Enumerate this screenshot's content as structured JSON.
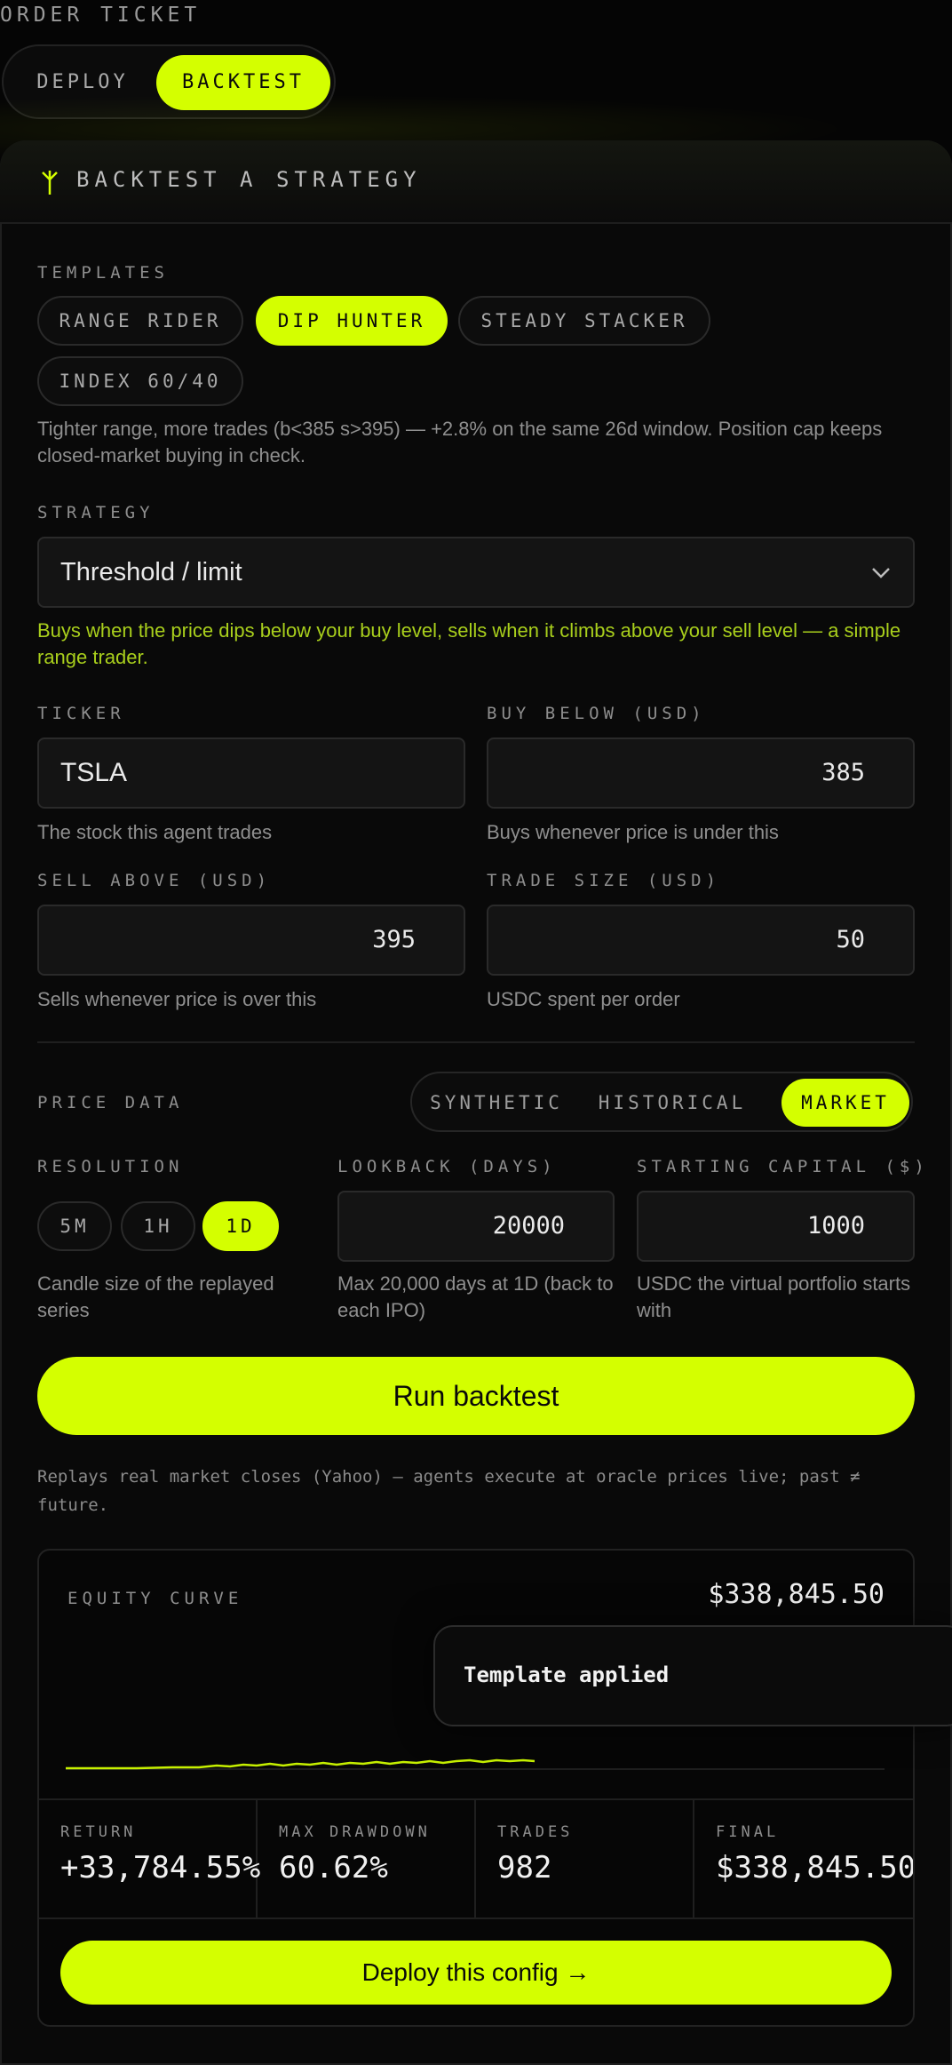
{
  "page_title": "ORDER TICKET",
  "mode_toggle": {
    "deploy": "DEPLOY",
    "backtest": "BACKTEST",
    "selected": "BACKTEST"
  },
  "card_title": "BACKTEST A STRATEGY",
  "templates": {
    "label": "TEMPLATES",
    "items": [
      "RANGE RIDER",
      "DIP HUNTER",
      "STEADY STACKER",
      "INDEX 60/40"
    ],
    "selected": "DIP HUNTER",
    "description": "Tighter range, more trades (b<385 s>395) — +2.8% on the same 26d window. Position cap keeps closed-market buying in check."
  },
  "strategy": {
    "label": "STRATEGY",
    "value": "Threshold / limit",
    "description": "Buys when the price dips below your buy level, sells when it climbs above your sell level — a simple range trader."
  },
  "ticker": {
    "label": "TICKER",
    "value": "TSLA",
    "help": "The stock this agent trades"
  },
  "buy_below": {
    "label": "BUY BELOW (USD)",
    "value": "385",
    "help": "Buys whenever price is under this"
  },
  "sell_above": {
    "label": "SELL ABOVE (USD)",
    "value": "395",
    "help": "Sells whenever price is over this"
  },
  "trade_size": {
    "label": "TRADE SIZE (USD)",
    "value": "50",
    "help": "USDC spent per order"
  },
  "price_data": {
    "label": "PRICE DATA",
    "options": [
      "SYNTHETIC",
      "HISTORICAL",
      "MARKET"
    ],
    "selected": "MARKET"
  },
  "resolution": {
    "label": "RESOLUTION",
    "options": [
      "5M",
      "1H",
      "1D"
    ],
    "selected": "1D",
    "help": "Candle size of the replayed series"
  },
  "lookback": {
    "label": "LOOKBACK (DAYS)",
    "value": "20000",
    "help": "Max 20,000 days at 1D (back to each IPO)"
  },
  "starting_capital": {
    "label": "STARTING CAPITAL ($)",
    "value": "1000",
    "help": "USDC the virtual portfolio starts with"
  },
  "run_button": "Run backtest",
  "disclaimer": "Replays real market closes (Yahoo) — agents execute at oracle prices live; past ≠ future.",
  "equity": {
    "label": "EQUITY CURVE",
    "total": "$338,845.50"
  },
  "toast": "Template applied",
  "stats": {
    "return": {
      "label": "RETURN",
      "value": "+33,784.55%"
    },
    "max_drawdown": {
      "label": "MAX DRAWDOWN",
      "value": "60.62%"
    },
    "trades": {
      "label": "TRADES",
      "value": "982"
    },
    "final": {
      "label": "FINAL",
      "value": "$338,845.50"
    }
  },
  "deploy_button": "Deploy this config →",
  "colors": {
    "accent": "#d4ff00",
    "background": "#050505",
    "panel": "#141414"
  }
}
